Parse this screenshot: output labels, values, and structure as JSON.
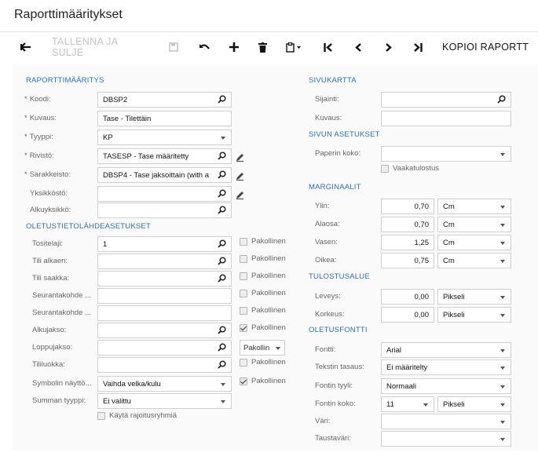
{
  "page": {
    "title": "Raporttimääritykset"
  },
  "toolbar": {
    "save_close": "TALLENNA JA SULJE",
    "copy_report": "KOPIOI RAPORTT"
  },
  "left": {
    "section1": "RAPORTTIMÄÄRITYS",
    "koodi_label": "Koodi:",
    "koodi": "DBSP2",
    "kuvaus_label": "Kuvaus:",
    "kuvaus": "Tase - Tilettäin",
    "tyyppi_label": "Tyyppi:",
    "tyyppi": "KP",
    "rivisto_label": "Rivistö:",
    "rivisto": "TASESP - Tase määritetty",
    "sarakkeisto_label": "Sarakkeisto:",
    "sarakkeisto": "DBSP4 - Tase jaksoittain (with a",
    "yksikosto_label": "Yksikköstö:",
    "yksikosto": "",
    "alkuyksikko_label": "Alkuyksikkö:",
    "alkuyksikko": "",
    "section2": "OLETUSTIETOLÄHDEASETUKSET",
    "tositelaji_label": "Tositelaji:",
    "tositelaji": "1",
    "tili_alkaen_label": "Tili alkaen:",
    "tili_alkaen": "",
    "tili_saakka_label": "Tili saakka:",
    "tili_saakka": "",
    "seuranta1_label": "Seurantakohde ...",
    "seuranta1": "",
    "seuranta2_label": "Seurantakohde ...",
    "seuranta2": "",
    "alkujakso_label": "Alkujakso:",
    "alkujakso": "",
    "loppujakso_label": "Loppujakso:",
    "loppujakso": "",
    "tililuokka_label": "Tililuokka:",
    "tililuokka": "",
    "symboli_label": "Symbolin näyttö...",
    "symboli": "Vaihda velka/kulu",
    "summan_label": "Summan tyyppi:",
    "summan": "Ei valittu",
    "pakollinen": "Pakollinen",
    "pakollinen_select": "Pakollin",
    "rajoitus": "Käytä rajoitusryhmiä"
  },
  "right": {
    "sivukartta": "SIVUKARTTA",
    "sijainti_label": "Sijainti:",
    "sijainti": "",
    "kuvaus_label": "Kuvaus:",
    "kuvaus": "",
    "sivun_asetukset": "SIVUN ASETUKSET",
    "paperin_label": "Paperin koko:",
    "paperin": "",
    "vaakatulostus": "Vaakatulostus",
    "marginaalit": "MARGINAALIT",
    "ylin_label": "Ylin:",
    "ylin": "0,70",
    "ylin_unit": "Cm",
    "alaosa_label": "Alaosa:",
    "alaosa": "0,70",
    "alaosa_unit": "Cm",
    "vasen_label": "Vasen:",
    "vasen": "1,25",
    "vasen_unit": "Cm",
    "oikea_label": "Oikea:",
    "oikea": "0,75",
    "oikea_unit": "Cm",
    "tulostusalue": "TULOSTUSALUE",
    "leveys_label": "Leveys:",
    "leveys": "0,00",
    "leveys_unit": "Pikseli",
    "korkeus_label": "Korkeus:",
    "korkeus": "0,00",
    "korkeus_unit": "Pikseli",
    "oletusfontti": "OLETUSFONTTI",
    "fontti_label": "Fontti:",
    "fontti": "Arial",
    "tasaus_label": "Tekstin tasaus:",
    "tasaus": "Ei määritelty",
    "tyyli_label": "Fontin tyyli:",
    "tyyli": "Normaali",
    "koko_label": "Fontin koko:",
    "koko": "11",
    "koko_unit": "Pikseli",
    "vari_label": "Väri:",
    "vari": "",
    "taustavari_label": "Taustaväri:",
    "taustavari": ""
  }
}
